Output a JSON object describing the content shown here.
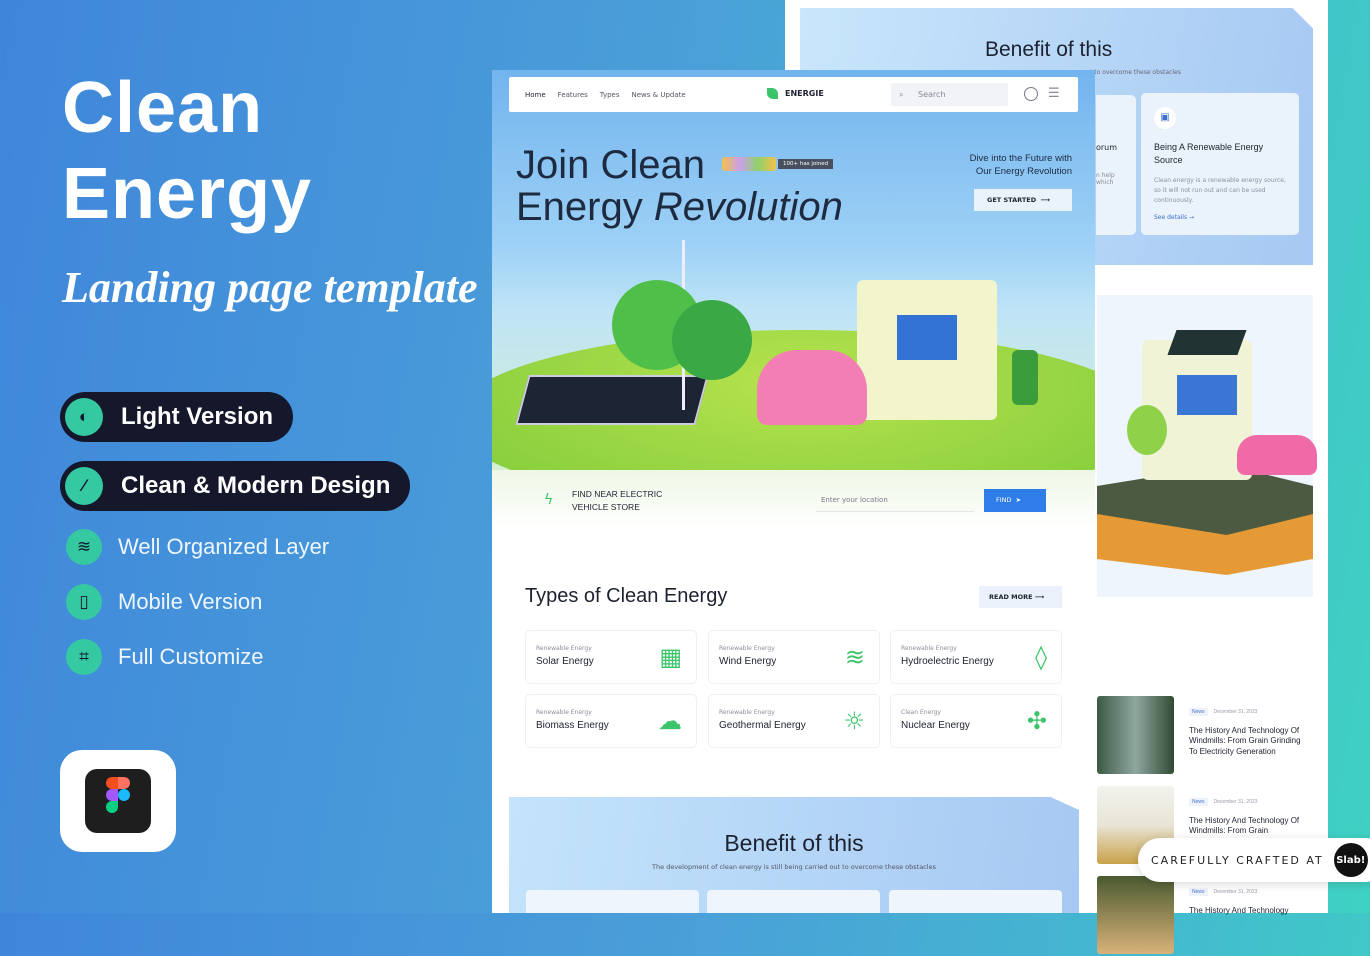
{
  "promo": {
    "title_line1": "Clean",
    "title_line2": "Energy",
    "subtitle": "Landing page template",
    "badges": [
      {
        "label": "Light Version",
        "icon": "contrast-icon"
      },
      {
        "label": "Clean & Modern Design",
        "icon": "magic-wand-icon"
      }
    ],
    "features": [
      {
        "label": "Well Organized Layer",
        "icon": "layers-icon"
      },
      {
        "label": "Mobile Version",
        "icon": "mobile-icon"
      },
      {
        "label": "Full Customize",
        "icon": "crop-icon"
      }
    ],
    "tool_icon": "figma-icon"
  },
  "nav": {
    "items": [
      "Home",
      "Features",
      "Types",
      "News & Update"
    ],
    "brand": "ENERGIE",
    "search_placeholder": "Search"
  },
  "hero": {
    "title_line1": "Join Clean",
    "title_line2_plain": "Energy ",
    "title_line2_italic": "Revolution",
    "joined": "100+ has joined",
    "tagline_line1": "Dive into the Future with",
    "tagline_line2": "Our Energy Revolution",
    "cta": "GET STARTED"
  },
  "finder": {
    "line1": "FIND NEAR ELECTRIC",
    "line2": "VEHICLE STORE",
    "placeholder": "Enter your location",
    "button": "FIND"
  },
  "types": {
    "heading": "Types of Clean Energy",
    "read_more": "READ MORE",
    "cards": [
      {
        "kicker": "Renewable Energy",
        "title": "Solar Energy",
        "icon": "solar-panel-icon"
      },
      {
        "kicker": "Renewable Energy",
        "title": "Wind Energy",
        "icon": "wind-icon"
      },
      {
        "kicker": "Renewable Energy",
        "title": "Hydroelectric Energy",
        "icon": "water-drop-ph-icon"
      },
      {
        "kicker": "Renewable Energy",
        "title": "Biomass Energy",
        "icon": "cloud-rain-icon"
      },
      {
        "kicker": "Renewable Energy",
        "title": "Geothermal Energy",
        "icon": "sun-icon"
      },
      {
        "kicker": "Clean Energy",
        "title": "Nuclear Energy",
        "icon": "molecule-icon"
      }
    ]
  },
  "benefit": {
    "heading": "Benefit of this",
    "subtitle": "The development of clean energy is still being carried out to overcome these obstacles"
  },
  "back_page": {
    "benefit_heading": "Benefit of this",
    "benefit_sub_fragment": "t to overcome these obstacles",
    "partial_card_title": "orum",
    "partial_card_text1": "n help",
    "partial_card_text2": "which",
    "card_title": "Being A Renewable Energy Source",
    "card_text": "Clean energy is a renewable energy source, so it will not run out and can be used continuously.",
    "card_link": "See details",
    "news": [
      {
        "tag": "News",
        "date": "December 31, 2023",
        "title": "The History And Technology Of Windmills: From Grain Grinding To Electricity Generation"
      },
      {
        "tag": "News",
        "date": "December 31, 2023",
        "title": "The History And Technology Of Windmills: From Grain"
      },
      {
        "tag": "News",
        "date": "December 31, 2023",
        "title": "The History And Technology"
      }
    ]
  },
  "credit": {
    "text": "CAREFULLY CRAFTED AT",
    "logo": "Slab!"
  },
  "colors": {
    "accent_green": "#3cc46a",
    "find_blue": "#2f7de8",
    "badge_dark": "#15172b",
    "badge_teal": "#35c9a2"
  }
}
